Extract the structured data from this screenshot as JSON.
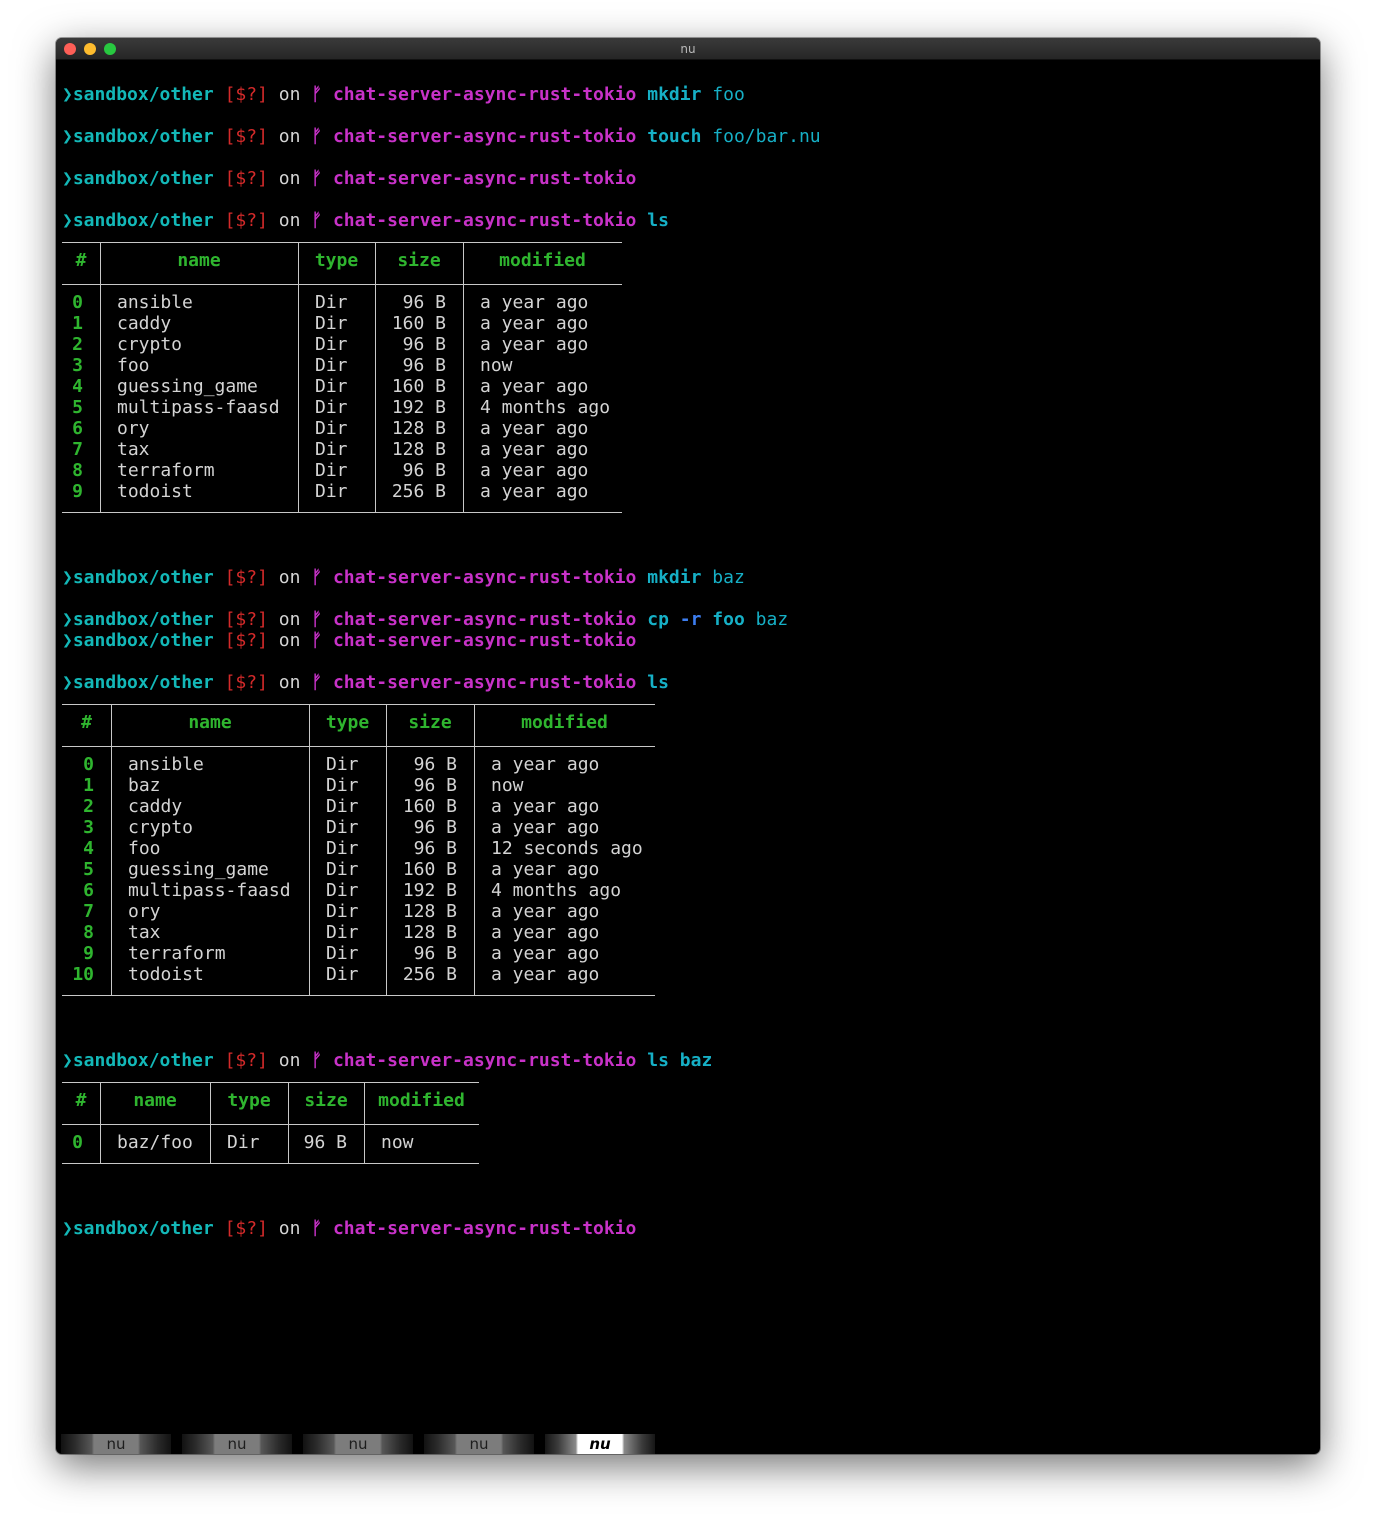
{
  "window": {
    "title": "nu"
  },
  "prompt": {
    "arrow": "❯",
    "path": "sandbox/other",
    "status": "[$?]",
    "on": "on",
    "branch_icon": "ᚠ",
    "branch": "chat-server-async-rust-tokio"
  },
  "commands": [
    {
      "cmd": "mkdir",
      "args": [
        {
          "text": "foo",
          "kind": "arg"
        }
      ]
    },
    {
      "cmd": "touch",
      "args": [
        {
          "text": "foo/bar.nu",
          "kind": "arg"
        }
      ]
    },
    {
      "cmd": "",
      "args": []
    },
    {
      "cmd": "ls",
      "args": []
    },
    {
      "cmd": "mkdir",
      "args": [
        {
          "text": "baz",
          "kind": "arg"
        }
      ]
    },
    {
      "cmd": "cp",
      "args": [
        {
          "text": "-r",
          "kind": "flag"
        },
        {
          "text": "foo",
          "kind": "cmd"
        },
        {
          "text": "baz",
          "kind": "arg"
        }
      ]
    },
    {
      "cmd": "",
      "args": []
    },
    {
      "cmd": "ls",
      "args": []
    },
    {
      "cmd": "ls",
      "args": [
        {
          "text": "baz",
          "kind": "cmd"
        }
      ]
    },
    {
      "cmd": "",
      "args": []
    }
  ],
  "tables": [
    {
      "headers": [
        "#",
        "name",
        "type",
        "size",
        "modified"
      ],
      "rows": [
        [
          "0",
          "ansible",
          "Dir",
          "96 B",
          "a year ago"
        ],
        [
          "1",
          "caddy",
          "Dir",
          "160 B",
          "a year ago"
        ],
        [
          "2",
          "crypto",
          "Dir",
          "96 B",
          "a year ago"
        ],
        [
          "3",
          "foo",
          "Dir",
          "96 B",
          "now"
        ],
        [
          "4",
          "guessing_game",
          "Dir",
          "160 B",
          "a year ago"
        ],
        [
          "5",
          "multipass-faasd",
          "Dir",
          "192 B",
          "4 months ago"
        ],
        [
          "6",
          "ory",
          "Dir",
          "128 B",
          "a year ago"
        ],
        [
          "7",
          "tax",
          "Dir",
          "128 B",
          "a year ago"
        ],
        [
          "8",
          "terraform",
          "Dir",
          "96 B",
          "a year ago"
        ],
        [
          "9",
          "todoist",
          "Dir",
          "256 B",
          "a year ago"
        ]
      ]
    },
    {
      "headers": [
        "#",
        "name",
        "type",
        "size",
        "modified"
      ],
      "rows": [
        [
          "0",
          "ansible",
          "Dir",
          "96 B",
          "a year ago"
        ],
        [
          "1",
          "baz",
          "Dir",
          "96 B",
          "now"
        ],
        [
          "2",
          "caddy",
          "Dir",
          "160 B",
          "a year ago"
        ],
        [
          "3",
          "crypto",
          "Dir",
          "96 B",
          "a year ago"
        ],
        [
          "4",
          "foo",
          "Dir",
          "96 B",
          "12 seconds ago"
        ],
        [
          "5",
          "guessing_game",
          "Dir",
          "160 B",
          "a year ago"
        ],
        [
          "6",
          "multipass-faasd",
          "Dir",
          "192 B",
          "4 months ago"
        ],
        [
          "7",
          "ory",
          "Dir",
          "128 B",
          "a year ago"
        ],
        [
          "8",
          "tax",
          "Dir",
          "128 B",
          "a year ago"
        ],
        [
          "9",
          "terraform",
          "Dir",
          "96 B",
          "a year ago"
        ],
        [
          "10",
          "todoist",
          "Dir",
          "256 B",
          "a year ago"
        ]
      ]
    },
    {
      "headers": [
        "#",
        "name",
        "type",
        "size",
        "modified"
      ],
      "rows": [
        [
          "0",
          "baz/foo",
          "Dir",
          "96 B",
          "now"
        ]
      ]
    }
  ],
  "tabs": [
    {
      "label": "nu",
      "active": false
    },
    {
      "label": "nu",
      "active": false
    },
    {
      "label": "nu",
      "active": false
    },
    {
      "label": "nu",
      "active": false
    },
    {
      "label": "nu",
      "active": true
    }
  ]
}
